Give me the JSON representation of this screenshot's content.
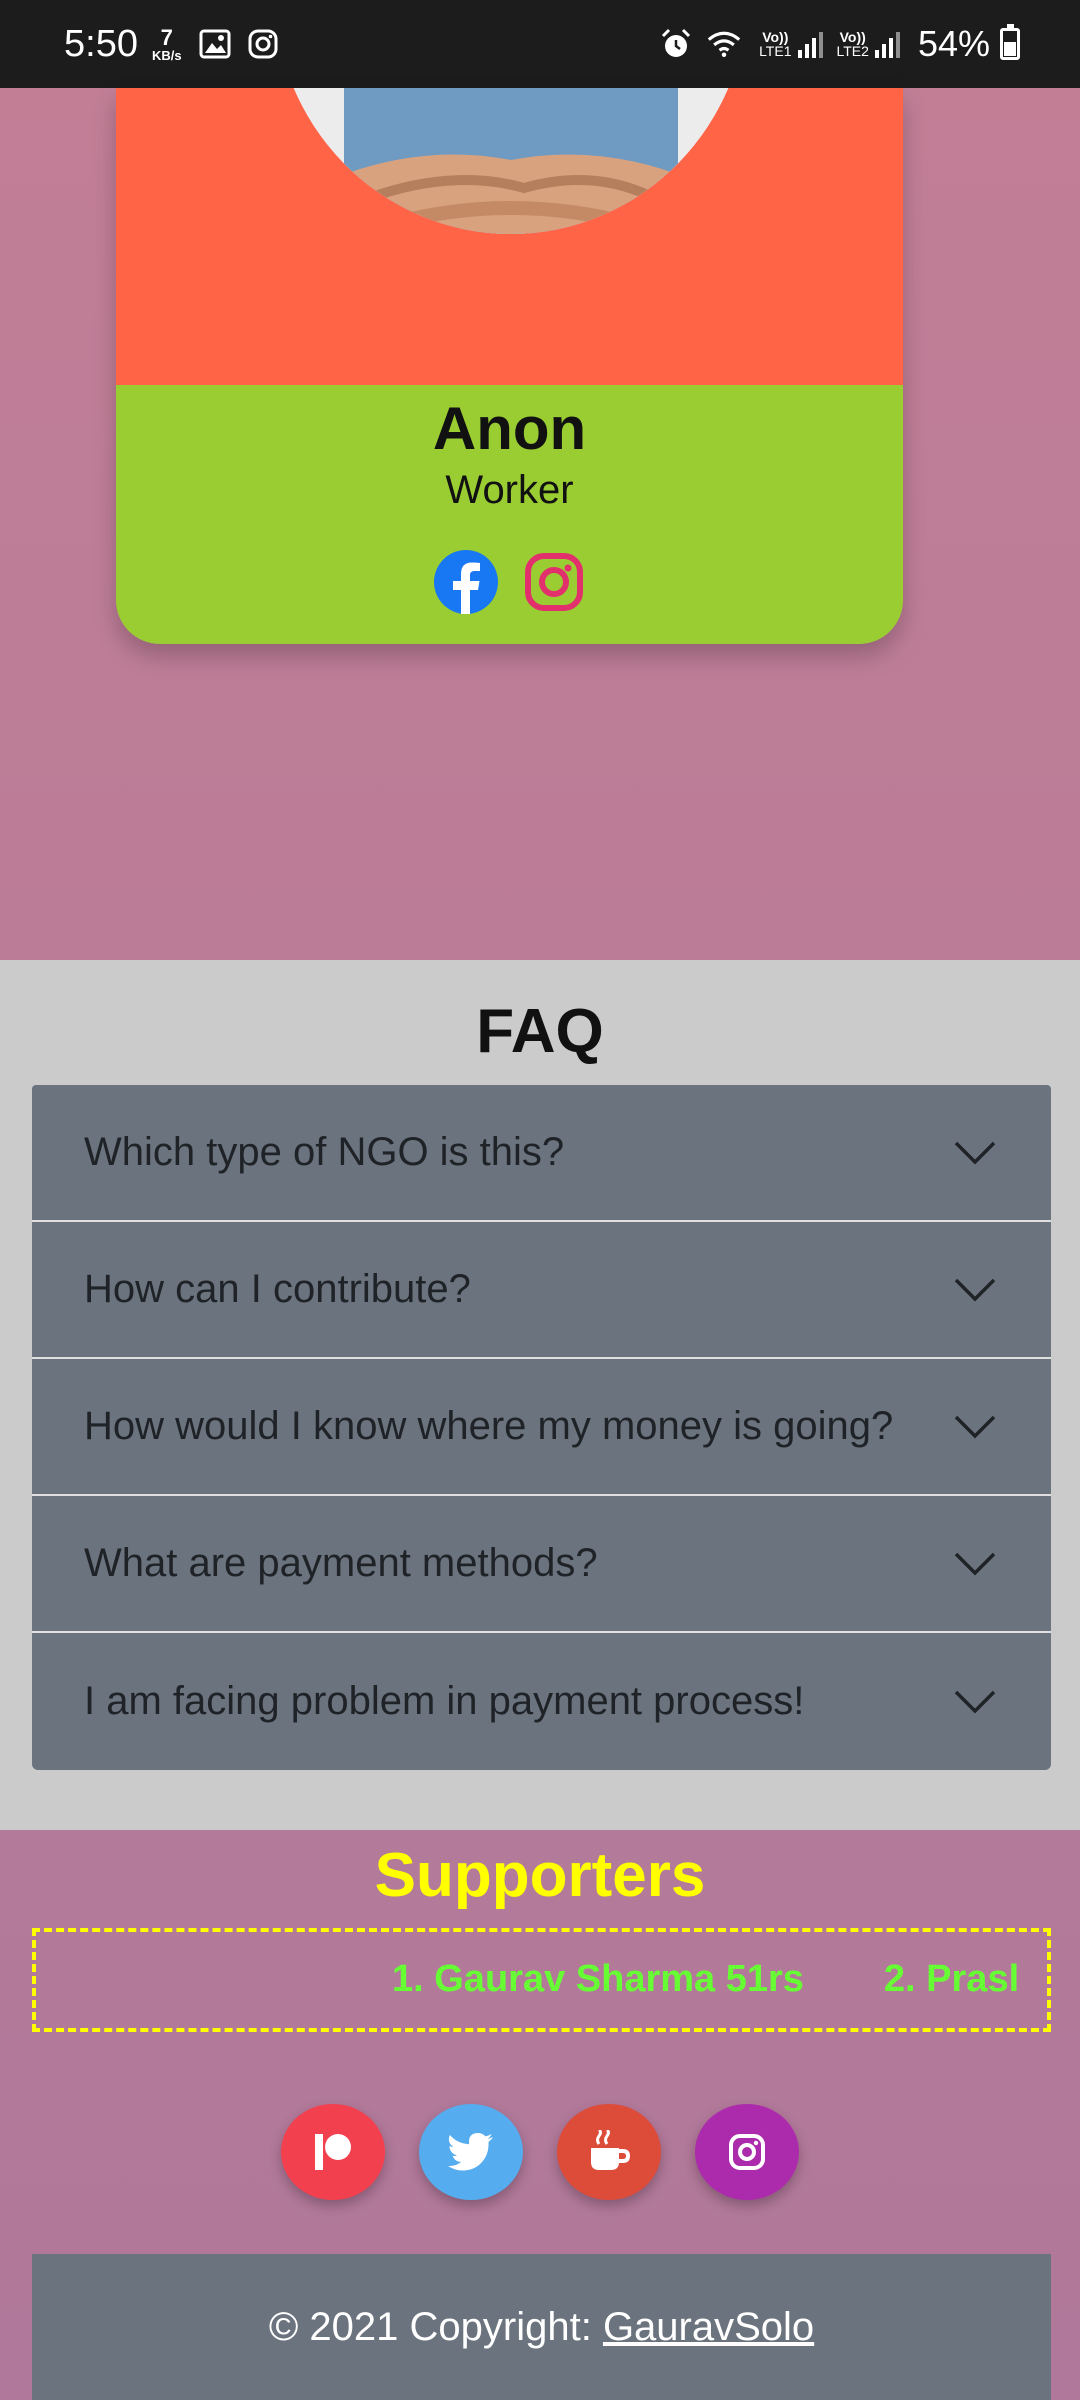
{
  "status_bar": {
    "time": "5:50",
    "speed_value": "7",
    "speed_unit": "KB/s",
    "net1_top": "Vo))",
    "net1_bottom": "LTE1",
    "net2_top": "Vo))",
    "net2_bottom": "LTE2",
    "battery": "54%"
  },
  "card": {
    "name": "Anon",
    "role": "Worker",
    "colors": {
      "top": "#ff6447",
      "bottom": "#9acd32"
    },
    "social_icons": [
      "facebook-icon",
      "instagram-icon"
    ]
  },
  "faq": {
    "title": "FAQ",
    "items": [
      {
        "question": "Which type of NGO is this?"
      },
      {
        "question": "How can I contribute?"
      },
      {
        "question": "How would I know where my money is going?"
      },
      {
        "question": "What are payment methods?"
      },
      {
        "question": "I am facing problem in payment process!"
      }
    ]
  },
  "supporters": {
    "title": "Supporters",
    "entries": [
      "1. Gaurav Sharma 51rs",
      "2. Prasl"
    ]
  },
  "social_buttons": [
    {
      "icon": "patreon-icon",
      "color": "#f3404f"
    },
    {
      "icon": "twitter-icon",
      "color": "#55acee"
    },
    {
      "icon": "coffee-icon",
      "color": "#dd4b39"
    },
    {
      "icon": "instagram-icon",
      "color": "#ac2bac"
    }
  ],
  "footer": {
    "text": "© 2021 Copyright: ",
    "link": "GauravSolo"
  }
}
